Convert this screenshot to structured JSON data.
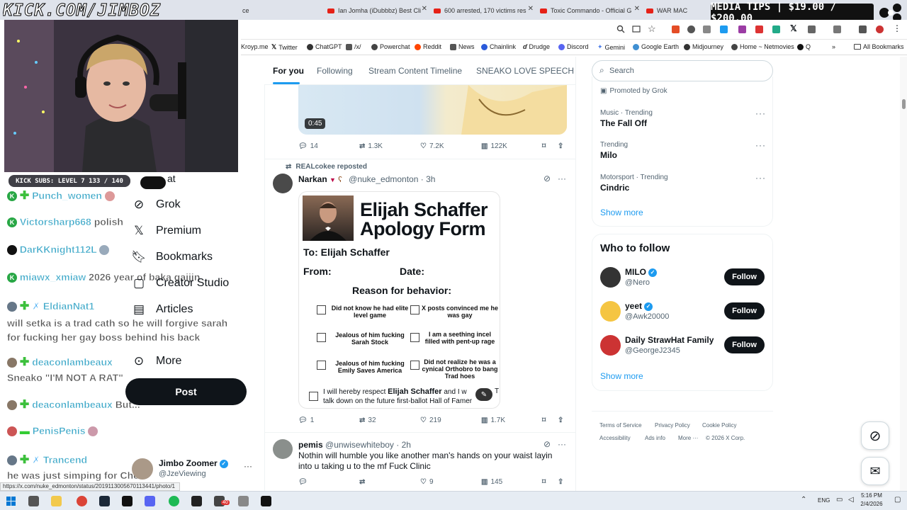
{
  "stream": {
    "kick_url": "KICK.COM/JIMBOZ",
    "kick_subs": "KICK SUBS: LEVEL 7 133 / 140",
    "media_tips": "MEDIA TIPS | $19.00 / $200.00"
  },
  "browser": {
    "tabs": [
      {
        "label": "Ian Jomha (iDubbbz) Best Cli"
      },
      {
        "label": "600 arrested, 170 victims res"
      },
      {
        "label": "Toxic Commando - Official G"
      },
      {
        "label": "WAR MAC"
      }
    ],
    "tab_partial": "ce",
    "bookmarks": [
      "Kroyp.me",
      "Twitter",
      "ChatGPT",
      "/x/",
      "Powerchat",
      "Reddit",
      "News",
      "Chainlink",
      "Drudge",
      "Discord",
      "Gemini",
      "Google Earth",
      "Midjourney",
      "Home ~ Netmovies",
      "Q"
    ],
    "all_bookmarks": "All Bookmarks",
    "status_url": "https://x.com/nuke_edmonton/status/2019113005670113441/photo/1"
  },
  "chat": [
    {
      "user": "Punch_women",
      "msg": ""
    },
    {
      "user": "Victorsharp668",
      "msg": "polish"
    },
    {
      "user": "DarKKnight112L",
      "msg": ""
    },
    {
      "user": "miawx_xmiaw",
      "msg": "2026 year of baka gaijin"
    },
    {
      "user": "EldianNat1",
      "msg": "will setka is a trad cath so he will forgive sarah for fucking her gay boss behind his back"
    },
    {
      "user": "deaconlambeaux",
      "msg": "Sneako \"I'M NOT A RAT\""
    },
    {
      "user": "deaconlambeaux",
      "msg": "But..."
    },
    {
      "user": "PenisPenis",
      "msg": ""
    },
    {
      "user": "Trancend",
      "msg": "he was just simping for Chen"
    }
  ],
  "nav": {
    "partial": "at",
    "items": [
      "Grok",
      "Premium",
      "Bookmarks",
      "Creator Studio",
      "Articles",
      "More"
    ],
    "post": "Post",
    "profile_name": "Jimbo Zoomer",
    "profile_handle": "@JzeViewing"
  },
  "feed": {
    "tabs": [
      "For you",
      "Following",
      "Stream Content Timeline",
      "SNEAKO LOVE SPEECH"
    ],
    "video_time": "0:45",
    "post1_actions": {
      "replies": "14",
      "reposts": "1.3K",
      "likes": "7.2K",
      "views": "122K"
    },
    "post2": {
      "reposted_by": "REALcokee reposted",
      "name": "Narkan",
      "handle": "@nuke_edmonton",
      "time": "· 3h",
      "actions": {
        "replies": "1",
        "reposts": "32",
        "likes": "219",
        "views": "1.7K"
      }
    },
    "form": {
      "title_line1": "Elijah Schaffer",
      "title_line2": "Apology Form",
      "to": "To: Elijah Schaffer",
      "from": "From:",
      "date": "Date:",
      "reason": "Reason for behavior:",
      "options": [
        "Did not know he had elite level game",
        "X posts convinced me he was gay",
        "Jealous of him fucking Sarah Stock",
        "I am a seething incel filled with pent-up rage",
        "Jealous of him fucking Emily Saves America",
        "Did not realize he was a cynical Orthobro to bang Trad hoes"
      ],
      "pledge_start": "I will hereby respect",
      "pledge_name": "Elijah Schaffer",
      "pledge_end": "and I w",
      "pledge_letter": "T",
      "pledge_line2": "talk down on the future first-ballot Hall of Famer"
    },
    "post3": {
      "name": "pemis",
      "handle": "@unwisewhiteboy",
      "time": "· 2h",
      "text": "Nothin will humble you like another man's hands on your waist layin into u taking u to the mf Fuck Clinic",
      "actions": {
        "likes": "9",
        "views": "145"
      }
    }
  },
  "sidebar": {
    "search_placeholder": "Search",
    "promoted": "Promoted by Grok",
    "trends": [
      {
        "label": "Music · Trending",
        "name": "The Fall Off"
      },
      {
        "label": "Trending",
        "name": "Milo"
      },
      {
        "label": "Motorsport · Trending",
        "name": "Cindric"
      }
    ],
    "show_more": "Show more",
    "who_to_follow_title": "Who to follow",
    "follow_label": "Follow",
    "who_to_follow": [
      {
        "name": "MILO",
        "handle": "@Nero"
      },
      {
        "name": "yeet",
        "handle": "@Awk20000"
      },
      {
        "name": "Daily StrawHat Family",
        "handle": "@GeorgeJ2345"
      }
    ],
    "footer_line1": [
      "Terms of Service",
      "Privacy Policy",
      "Cookie Policy"
    ],
    "footer_line2": [
      "Accessibility",
      "Ads info",
      "More ···",
      "© 2026 X Corp."
    ]
  },
  "taskbar": {
    "lang": "ENG",
    "time": "5:16 PM",
    "date": "2/4/2026",
    "badge": "40"
  }
}
